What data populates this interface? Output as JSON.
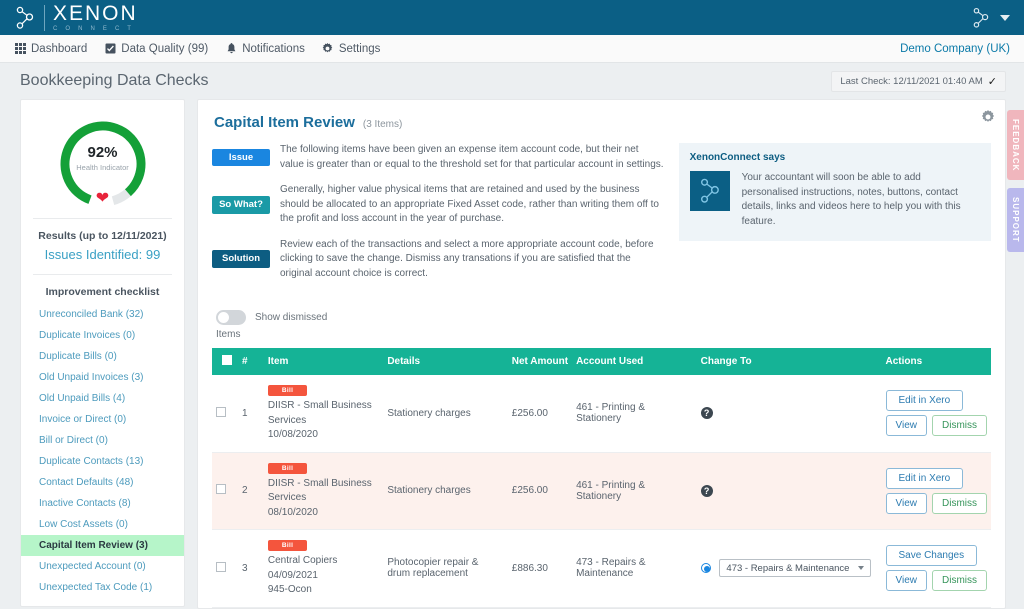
{
  "brand": {
    "name": "XENON",
    "sub": "C O N N E C T",
    "logo_icon": "xenon-node-logo"
  },
  "topbar": {
    "account_icon": "xenon-node-icon",
    "caret_icon": "chevron-down-icon"
  },
  "menubar": {
    "items": [
      {
        "label": "Dashboard",
        "icon": "grid-icon"
      },
      {
        "label": "Data Quality (99)",
        "icon": "check-square-icon"
      },
      {
        "label": "Notifications",
        "icon": "bell-icon"
      },
      {
        "label": "Settings",
        "icon": "gear-icon"
      }
    ],
    "company": "Demo Company (UK)"
  },
  "page": {
    "title": "Bookkeeping Data Checks",
    "last_check": "Last Check: 12/11/2021 01:40 AM",
    "last_check_icon": "check-tick-icon"
  },
  "sidebar": {
    "gauge": {
      "percent": "92%",
      "label": "Health Indicator",
      "value": 92,
      "heart_icon": "heart-icon",
      "color": "#14a038"
    },
    "results": "Results (up to 12/11/2021)",
    "issues": "Issues Identified: 99",
    "checklist_title": "Improvement checklist",
    "items": [
      {
        "label": "Unreconciled Bank (32)",
        "active": false
      },
      {
        "label": "Duplicate Invoices (0)",
        "active": false
      },
      {
        "label": "Duplicate Bills (0)",
        "active": false
      },
      {
        "label": "Old Unpaid Invoices (3)",
        "active": false
      },
      {
        "label": "Old Unpaid Bills (4)",
        "active": false
      },
      {
        "label": "Invoice or Direct (0)",
        "active": false
      },
      {
        "label": "Bill or Direct (0)",
        "active": false
      },
      {
        "label": "Duplicate Contacts (13)",
        "active": false
      },
      {
        "label": "Contact Defaults (48)",
        "active": false
      },
      {
        "label": "Inactive Contacts (8)",
        "active": false
      },
      {
        "label": "Low Cost Assets (0)",
        "active": false
      },
      {
        "label": "Capital Item Review (3)",
        "active": true
      },
      {
        "label": "Unexpected Account (0)",
        "active": false
      },
      {
        "label": "Unexpected Tax Code (1)",
        "active": false
      }
    ]
  },
  "main": {
    "title": "Capital Item Review",
    "count": "(3 Items)",
    "gear_icon": "gear-icon",
    "info": [
      {
        "badge": "Issue",
        "text": "The following items have been given an expense item account code, but their net value is greater than or equal to the threshold set for that particular account in settings."
      },
      {
        "badge": "So What?",
        "text": "Generally, higher value physical items that are retained and used by the business should be allocated to an appropriate Fixed Asset code, rather than writing them off to the profit and loss account in the year of purchase."
      },
      {
        "badge": "Solution",
        "text": "Review each of the transactions and select a more appropriate account code, before clicking to save the change. Dismiss any transations if you are satisfied that the original account choice is correct."
      }
    ],
    "xenon_panel": {
      "title": "XenonConnect says",
      "logo_icon": "xenon-node-logo",
      "text": "Your accountant will soon be able to add personalised instructions, notes, buttons, contact details, links and videos here to help you with this feature."
    },
    "toggle": {
      "label": "Show dismissed",
      "label2": "Items",
      "state": "off"
    },
    "table": {
      "headers": [
        "",
        "#",
        "Item",
        "Details",
        "Net Amount",
        "Account Used",
        "Change To",
        "Actions"
      ],
      "rows": [
        {
          "num": "1",
          "type": "Bill",
          "name": "DIISR - Small Business Services",
          "date": "10/08/2020",
          "ref": "",
          "details": "Stationery charges",
          "net": "£256.00",
          "account": "461 - Printing & Stationery",
          "change_to": "help",
          "change_value": "",
          "actions": {
            "primary": "Edit in Xero",
            "view": "View",
            "dismiss": "Dismiss"
          },
          "alt": false
        },
        {
          "num": "2",
          "type": "Bill",
          "name": "DIISR - Small Business Services",
          "date": "08/10/2020",
          "ref": "",
          "details": "Stationery charges",
          "net": "£256.00",
          "account": "461 - Printing & Stationery",
          "change_to": "help",
          "change_value": "",
          "actions": {
            "primary": "Edit in Xero",
            "view": "View",
            "dismiss": "Dismiss"
          },
          "alt": true
        },
        {
          "num": "3",
          "type": "Bill",
          "name": "Central Copiers",
          "date": "04/09/2021",
          "ref": "945-Ocon",
          "details": "Photocopier repair & drum replacement",
          "net": "£886.30",
          "account": "473 - Repairs & Maintenance",
          "change_to": "select",
          "change_value": "473 - Repairs & Maintenance",
          "actions": {
            "primary": "Save Changes",
            "view": "View",
            "dismiss": "Dismiss"
          },
          "alt": false
        }
      ]
    }
  },
  "rail": {
    "feedback": "FEEDBACK",
    "support": "SUPPORT"
  },
  "colors": {
    "header_blue": "#0b5f85",
    "table_header": "#15b396",
    "badge_issue": "#1a86e0",
    "badge_sowhat": "#1a9aa6",
    "badge_solution": "#0d5d82",
    "type_badge": "#f4553d",
    "gauge_green": "#14a038",
    "active_item": "#b6f5c9"
  }
}
